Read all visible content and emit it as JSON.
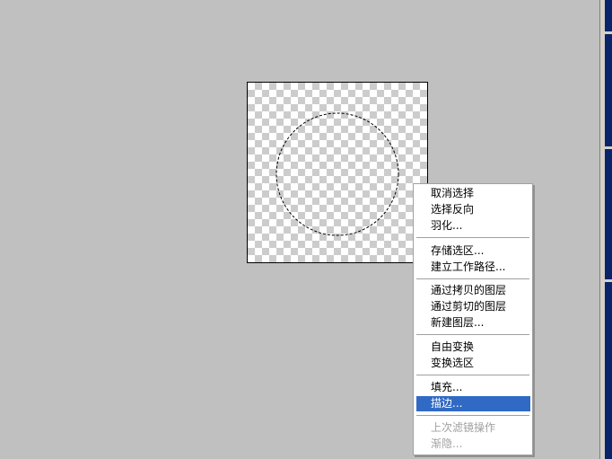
{
  "context_menu": {
    "items": [
      {
        "label": "取消选择",
        "state": "normal"
      },
      {
        "label": "选择反向",
        "state": "normal"
      },
      {
        "label": "羽化...",
        "state": "normal"
      },
      {
        "label": "存储选区...",
        "state": "normal"
      },
      {
        "label": "建立工作路径...",
        "state": "normal"
      },
      {
        "label": "通过拷贝的图层",
        "state": "normal"
      },
      {
        "label": "通过剪切的图层",
        "state": "normal"
      },
      {
        "label": "新建图层...",
        "state": "normal"
      },
      {
        "label": "自由变换",
        "state": "normal"
      },
      {
        "label": "变换选区",
        "state": "normal"
      },
      {
        "label": "填充...",
        "state": "normal"
      },
      {
        "label": "描边...",
        "state": "highlighted"
      },
      {
        "label": "上次滤镜操作",
        "state": "disabled"
      },
      {
        "label": "渐隐...",
        "state": "disabled"
      }
    ]
  },
  "colors": {
    "workspace": "#c0c0c0",
    "highlight": "#316ac5",
    "disabled_text": "#a0a0a0"
  }
}
